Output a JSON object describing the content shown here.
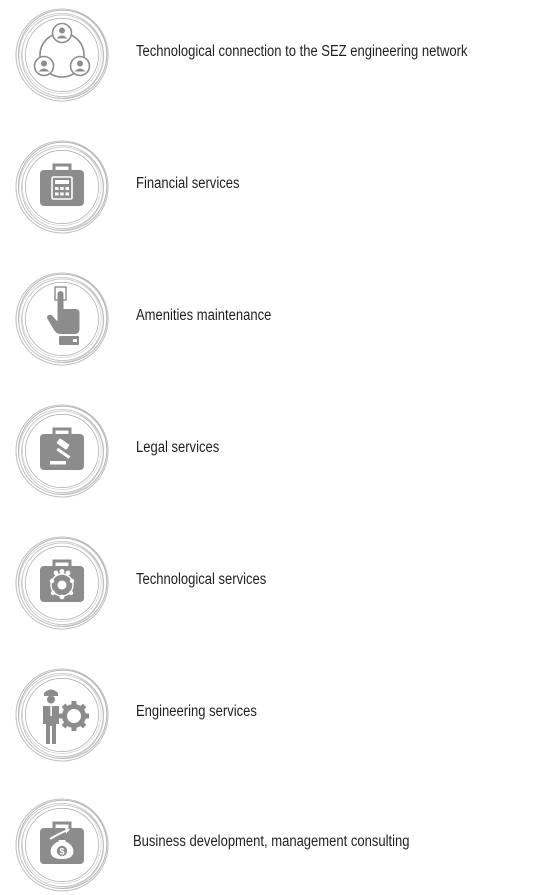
{
  "services": [
    {
      "label": "Technological connection to the SEZ engineering network",
      "icon": "network-people-icon"
    },
    {
      "label": "Financial services",
      "icon": "calculator-case-icon"
    },
    {
      "label": "Amenities maintenance",
      "icon": "pointing-hand-icon"
    },
    {
      "label": "Legal services",
      "icon": "gavel-case-icon"
    },
    {
      "label": "Technological services",
      "icon": "team-globe-case-icon"
    },
    {
      "label": "Engineering services",
      "icon": "engineer-gear-icon"
    },
    {
      "label": "Business development, management consulting",
      "icon": "money-growth-case-icon"
    }
  ],
  "colors": {
    "icon_gray": "#8c8c8c",
    "ring_gray": "#b4b4b4",
    "text": "#1f1f1f"
  }
}
